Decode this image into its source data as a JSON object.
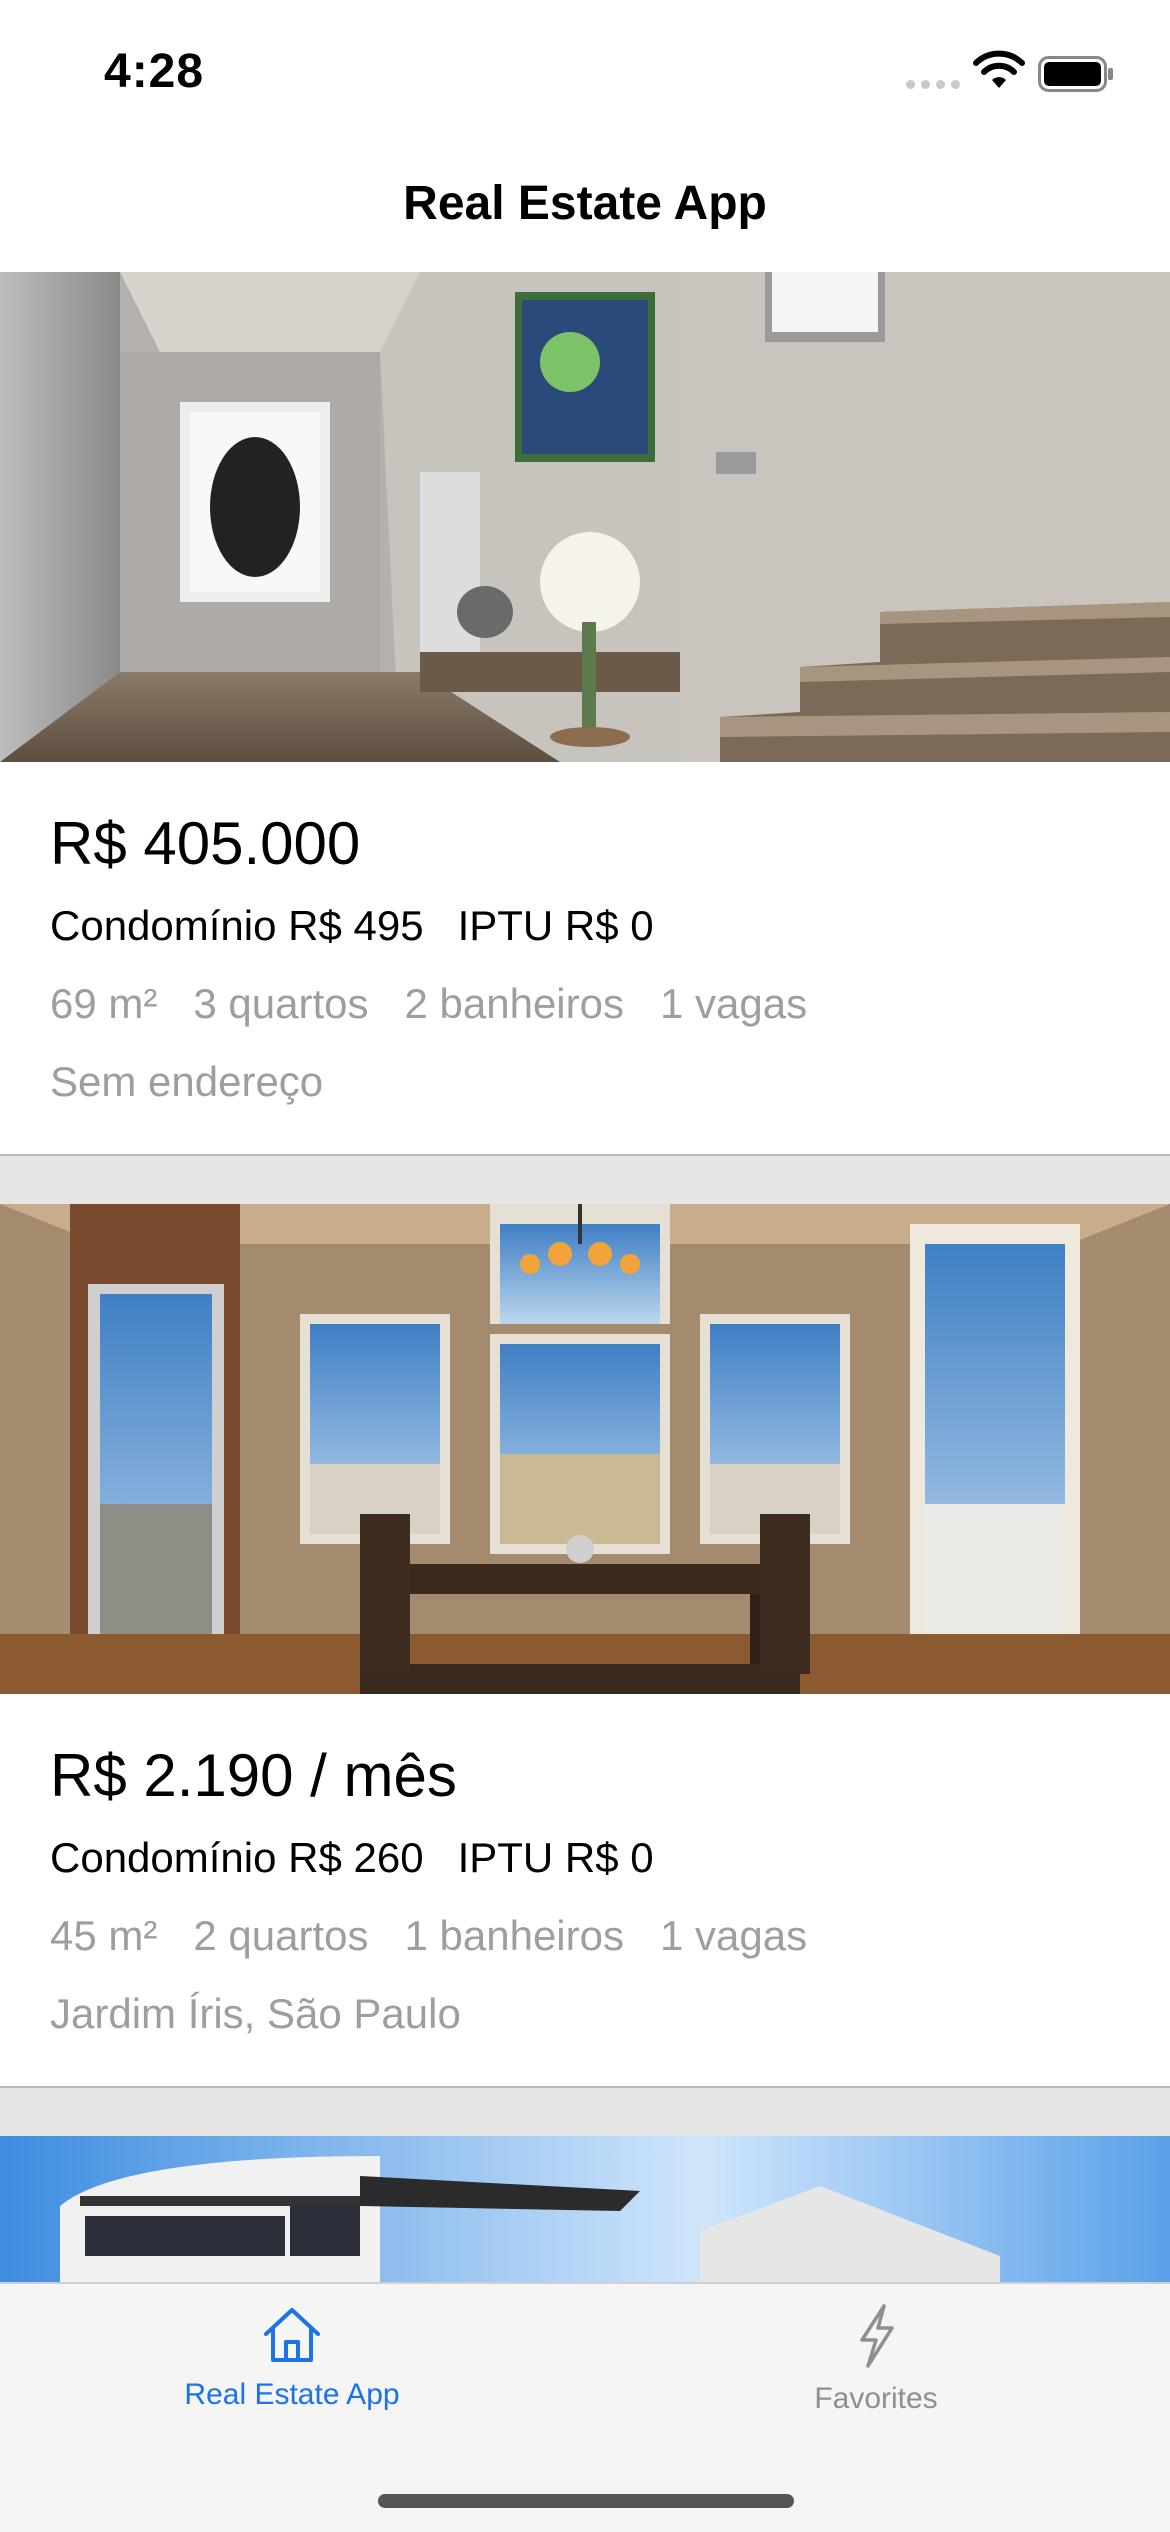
{
  "status_bar": {
    "time": "4:28"
  },
  "nav": {
    "title": "Real Estate App"
  },
  "listings": [
    {
      "price": "R$ 405.000",
      "condo": "Condomínio R$ 495",
      "iptu": "IPTU R$ 0",
      "area": "69 m²",
      "bedrooms": "3 quartos",
      "bathrooms": "2 banheiros",
      "parking": "1 vagas",
      "address": "Sem endereço"
    },
    {
      "price": "R$ 2.190 / mês",
      "condo": "Condomínio R$ 260",
      "iptu": "IPTU R$ 0",
      "area": "45 m²",
      "bedrooms": "2 quartos",
      "bathrooms": "1 banheiros",
      "parking": "1 vagas",
      "address": "Jardim Íris, São Paulo"
    }
  ],
  "tab_bar": {
    "tabs": [
      {
        "label": "Real Estate App",
        "icon": "house-icon",
        "active": true
      },
      {
        "label": "Favorites",
        "icon": "lightning-icon",
        "active": false
      }
    ],
    "active_color": "#1a73e8",
    "inactive_color": "#8e8e93"
  }
}
